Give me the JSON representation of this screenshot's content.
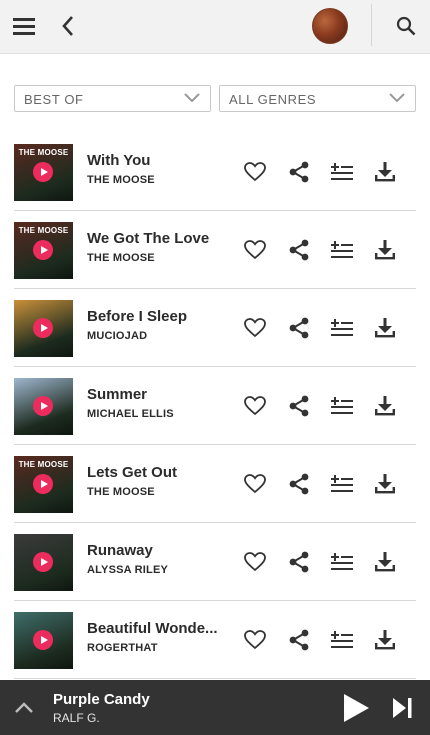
{
  "header": {
    "menu_icon": "hamburger-menu-icon",
    "back_icon": "chevron-left-icon",
    "search_icon": "search-icon"
  },
  "filters": {
    "period_label": "BEST OF",
    "genre_label": "ALL GENRES"
  },
  "tracks": [
    {
      "title": "With You",
      "artist": "THE MOOSE",
      "thumb_caption": "THE MOOSE",
      "thumb_color": "#5a2a20"
    },
    {
      "title": "We Got The Love",
      "artist": "THE MOOSE",
      "thumb_caption": "THE MOOSE",
      "thumb_color": "#5a2a20"
    },
    {
      "title": "Before I Sleep",
      "artist": "MUCIOJAD",
      "thumb_caption": "",
      "thumb_color": "#c9903a"
    },
    {
      "title": "Summer",
      "artist": "MICHAEL ELLIS",
      "thumb_caption": "",
      "thumb_color": "#9fb7cf"
    },
    {
      "title": "Lets Get Out",
      "artist": "THE MOOSE",
      "thumb_caption": "THE MOOSE",
      "thumb_color": "#5a2a20"
    },
    {
      "title": "Runaway",
      "artist": "ALYSSA RILEY",
      "thumb_caption": "",
      "thumb_color": "#3b3b3b"
    },
    {
      "title": "Beautiful Wonde...",
      "artist": "ROGERTHAT",
      "thumb_caption": "",
      "thumb_color": "#3f6d6a"
    }
  ],
  "player": {
    "title": "Purple Candy",
    "artist": "RALF G."
  },
  "colors": {
    "accent": "#ec2c5d",
    "player_bg": "#333333",
    "header_bg": "#f2f2f2"
  }
}
